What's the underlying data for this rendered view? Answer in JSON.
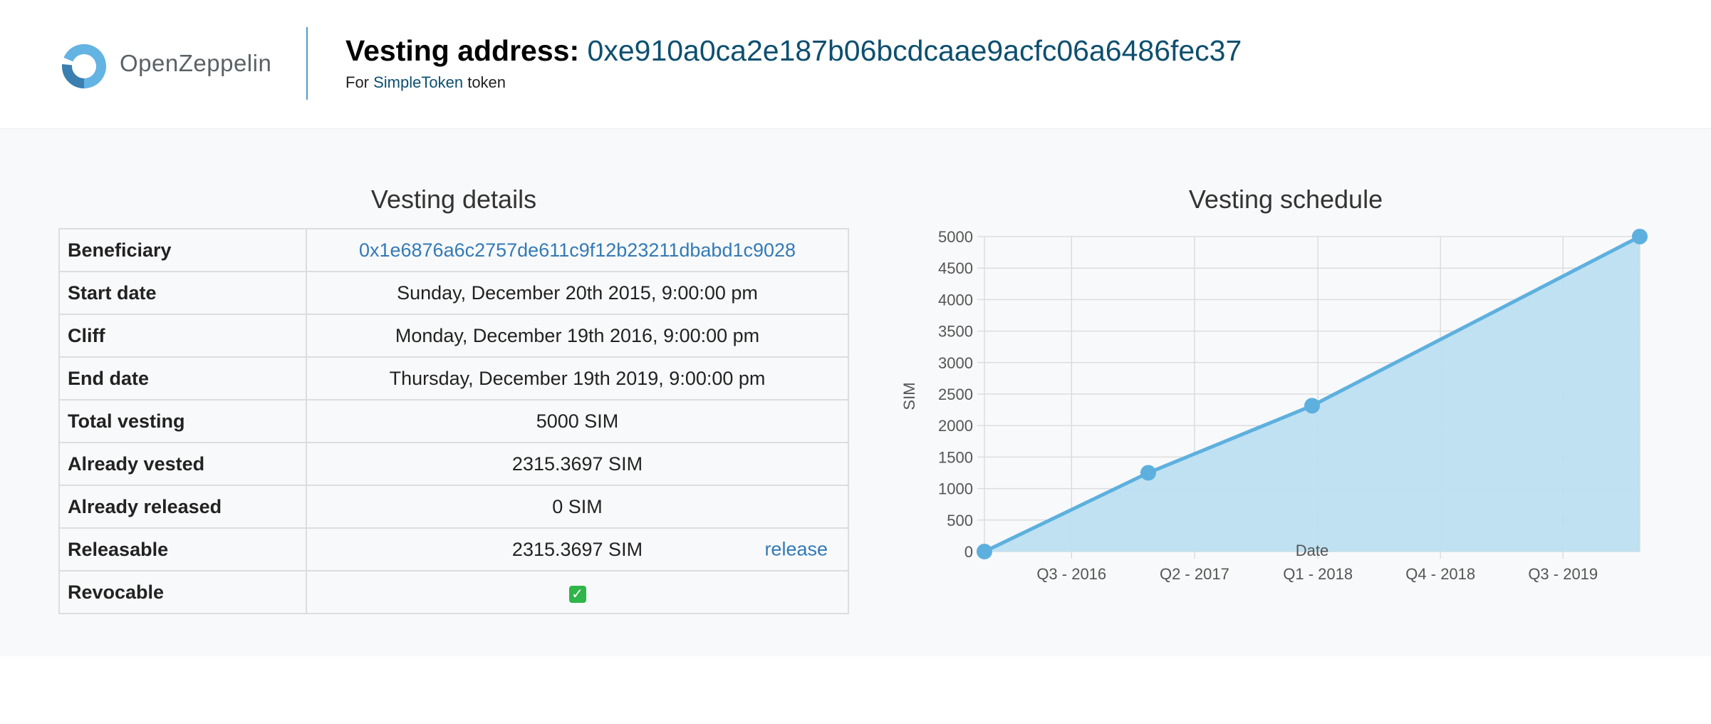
{
  "header": {
    "logo_text": "OpenZeppelin",
    "title_label": "Vesting address:",
    "address": "0xe910a0ca2e187b06bcdcaae9acfc06a6486fec37",
    "sub_prefix": "For",
    "token_name": "SimpleToken",
    "sub_suffix": "token"
  },
  "details": {
    "title": "Vesting details",
    "rows": [
      {
        "key": "Beneficiary",
        "value": "0x1e6876a6c2757de611c9f12b23211dbabd1c9028"
      },
      {
        "key": "Start date",
        "value": "Sunday, December 20th 2015, 9:00:00 pm"
      },
      {
        "key": "Cliff",
        "value": "Monday, December 19th 2016, 9:00:00 pm"
      },
      {
        "key": "End date",
        "value": "Thursday, December 19th 2019, 9:00:00 pm"
      },
      {
        "key": "Total vesting",
        "value": "5000 SIM"
      },
      {
        "key": "Already vested",
        "value": "2315.3697 SIM"
      },
      {
        "key": "Already released",
        "value": "0 SIM"
      },
      {
        "key": "Releasable",
        "value": "2315.3697 SIM",
        "action": "release"
      },
      {
        "key": "Revocable",
        "value": "✓"
      }
    ]
  },
  "colors": {
    "accent": "#337ab7",
    "address": "#0d4f6f",
    "chart_line": "#5db0de",
    "chart_fill": "#bcdff1",
    "check": "#2fb54a"
  },
  "chart_data": {
    "type": "area",
    "title": "Vesting schedule",
    "xlabel": "Date",
    "ylabel": "SIM",
    "x": [
      "2015-12-20",
      "2016-12-19",
      "2017-12-19",
      "2019-12-19"
    ],
    "y": [
      0,
      1250,
      2315.3697,
      5000
    ],
    "xlim": [
      "2015-12-20",
      "2019-12-19"
    ],
    "ylim": [
      0,
      5000
    ],
    "y_ticks": [
      0,
      500,
      1000,
      1500,
      2000,
      2500,
      3000,
      3500,
      4000,
      4500,
      5000
    ],
    "x_ticks": [
      {
        "label": "Q3 - 2016",
        "date": "2016-07-01"
      },
      {
        "label": "Q2 - 2017",
        "date": "2017-04-01"
      },
      {
        "label": "Q1 - 2018",
        "date": "2018-01-01"
      },
      {
        "label": "Q4 - 2018",
        "date": "2018-10-01"
      },
      {
        "label": "Q3 - 2019",
        "date": "2019-07-01"
      }
    ],
    "grid": true
  }
}
